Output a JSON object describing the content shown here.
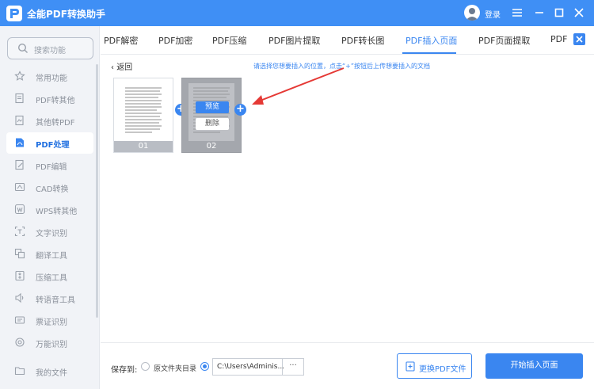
{
  "app": {
    "title": "全能PDF转换助手",
    "login_label": "登录"
  },
  "sidebar": {
    "search_placeholder": "搜索功能",
    "items": [
      {
        "label": "常用功能",
        "icon": "star-icon"
      },
      {
        "label": "PDF转其他",
        "icon": "pdf-export-icon"
      },
      {
        "label": "其他转PDF",
        "icon": "pdf-import-icon"
      },
      {
        "label": "PDF处理",
        "icon": "pdf-process-icon",
        "active": true
      },
      {
        "label": "PDF编辑",
        "icon": "pdf-edit-icon"
      },
      {
        "label": "CAD转换",
        "icon": "cad-icon"
      },
      {
        "label": "WPS转其他",
        "icon": "wps-icon"
      },
      {
        "label": "文字识别",
        "icon": "ocr-icon"
      },
      {
        "label": "翻译工具",
        "icon": "translate-icon"
      },
      {
        "label": "压缩工具",
        "icon": "compress-icon"
      },
      {
        "label": "转语音工具",
        "icon": "speech-icon"
      },
      {
        "label": "票证识别",
        "icon": "ticket-icon"
      },
      {
        "label": "万能识别",
        "icon": "universal-recognize-icon"
      },
      {
        "label": "我的文件",
        "icon": "my-files-icon"
      }
    ]
  },
  "tabs": [
    {
      "label": "PDF解密"
    },
    {
      "label": "PDF加密"
    },
    {
      "label": "PDF压缩"
    },
    {
      "label": "PDF图片提取"
    },
    {
      "label": "PDF转长图"
    },
    {
      "label": "PDF插入页面",
      "active": true
    },
    {
      "label": "PDF页面提取"
    },
    {
      "label": "PDF"
    }
  ],
  "content": {
    "back_label": "返回",
    "hint": "请选择您想要插入的位置，点击“+”按钮后上传想要插入的文档",
    "pages": [
      {
        "num": "01"
      },
      {
        "num": "02",
        "preview_label": "预览",
        "delete_label": "删除"
      }
    ]
  },
  "bottom": {
    "save_to_label": "保存到:",
    "option_source_dir": "原文件夹目录",
    "path_value": "C:\\Users\\Adminis...",
    "more_label": "···",
    "replace_button": "更换PDF文件",
    "start_button": "开始插入页面"
  },
  "colors": {
    "primary": "#3a86f0",
    "titlebar": "#3f8ff5",
    "sidebar_bg": "#f1f3f7",
    "hint_arrow": "#e53935"
  }
}
